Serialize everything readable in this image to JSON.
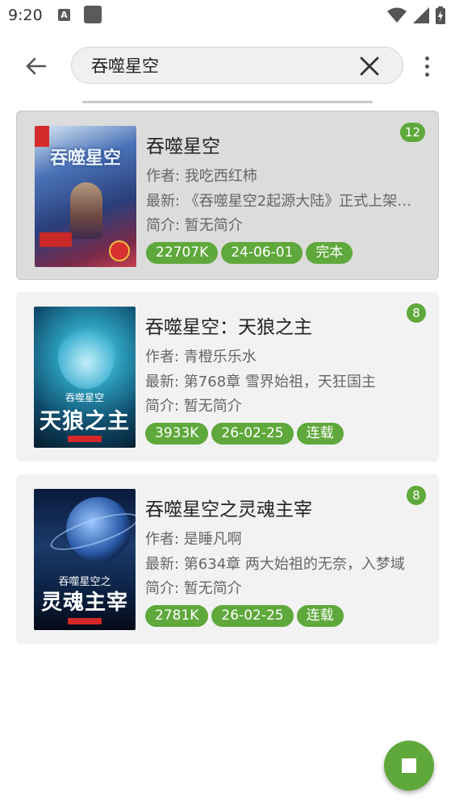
{
  "status_bar": {
    "time": "9:20",
    "notification_letter": "A"
  },
  "toolbar": {
    "search_value": "吞噬星空",
    "back_icon": "arrow-left-icon",
    "clear_icon": "close-icon",
    "more_icon": "more-vert-icon"
  },
  "results": [
    {
      "title": "吞噬星空",
      "author": "作者: 我吃西红柿",
      "latest": "最新: 《吞噬星空2起源大陆》正式上架…",
      "intro": "简介: 暂无简介",
      "count": "12",
      "tags": [
        "22707K",
        "24-06-01",
        "完本"
      ],
      "selected": true,
      "cover_text": "吞噬星空"
    },
    {
      "title": "吞噬星空：天狼之主",
      "author": "作者: 青橙乐乐水",
      "latest": "最新: 第768章 雪界始祖，天狂国主",
      "intro": "简介: 暂无简介",
      "count": "8",
      "tags": [
        "3933K",
        "26-02-25",
        "连载"
      ],
      "selected": false,
      "cover_text": [
        "吞噬星空",
        "天狼之主"
      ]
    },
    {
      "title": "吞噬星空之灵魂主宰",
      "author": "作者: 是睡凡啊",
      "latest": "最新: 第634章 两大始祖的无奈，入梦域",
      "intro": "简介: 暂无简介",
      "count": "8",
      "tags": [
        "2781K",
        "26-02-25",
        "连载"
      ],
      "selected": false,
      "cover_text": [
        "吞噬星空之",
        "灵魂主宰"
      ]
    }
  ],
  "fab": {
    "icon": "stop-icon"
  },
  "colors": {
    "accent": "#5fa83b",
    "card_bg": "#f2f2f2",
    "card_selected_bg": "#dcdcdc"
  }
}
